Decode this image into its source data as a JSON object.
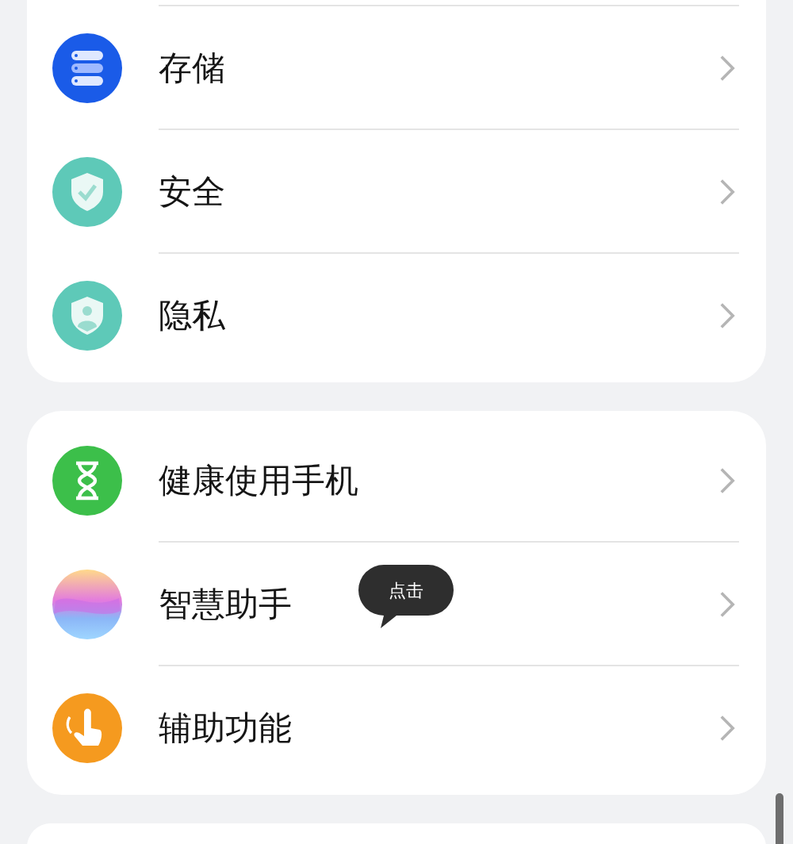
{
  "groups": [
    {
      "items": [
        {
          "label": "存储"
        },
        {
          "label": "安全"
        },
        {
          "label": "隐私"
        }
      ]
    },
    {
      "items": [
        {
          "label": "健康使用手机"
        },
        {
          "label": "智慧助手",
          "tooltip": "点击"
        },
        {
          "label": "辅助功能"
        }
      ]
    }
  ]
}
